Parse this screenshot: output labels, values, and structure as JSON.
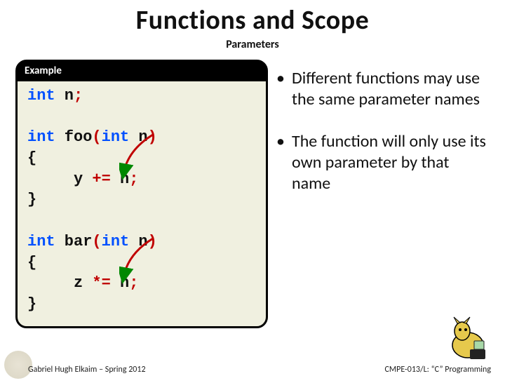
{
  "title": "Functions and Scope",
  "subtitle": "Parameters",
  "example_label": "Example",
  "code": {
    "l1_kw": "int",
    "l1_id": " n",
    "l1_semi": ";",
    "l3_kw": "int",
    "l3_id": " foo",
    "l3_open": "(",
    "l3_pkw": "int",
    "l3_pid": " n",
    "l3_close": ")",
    "l4_brace": "{",
    "l5_body_a": "     y ",
    "l5_op": "+=",
    "l5_body_b": " n",
    "l5_semi": ";",
    "l6_brace": "}",
    "l8_kw": "int",
    "l8_id": " bar",
    "l8_open": "(",
    "l8_pkw": "int",
    "l8_pid": " n",
    "l8_close": ")",
    "l9_brace": "{",
    "l10_body_a": "     z ",
    "l10_op": "*=",
    "l10_body_b": " n",
    "l10_semi": ";",
    "l11_brace": "}"
  },
  "bullets": [
    "Different functions may use the same parameter names",
    "The function will only use its own parameter by that name"
  ],
  "footer_left": "Gabriel Hugh Elkaim – Spring 2012",
  "footer_right": "CMPE-013/L: “C” Programming"
}
